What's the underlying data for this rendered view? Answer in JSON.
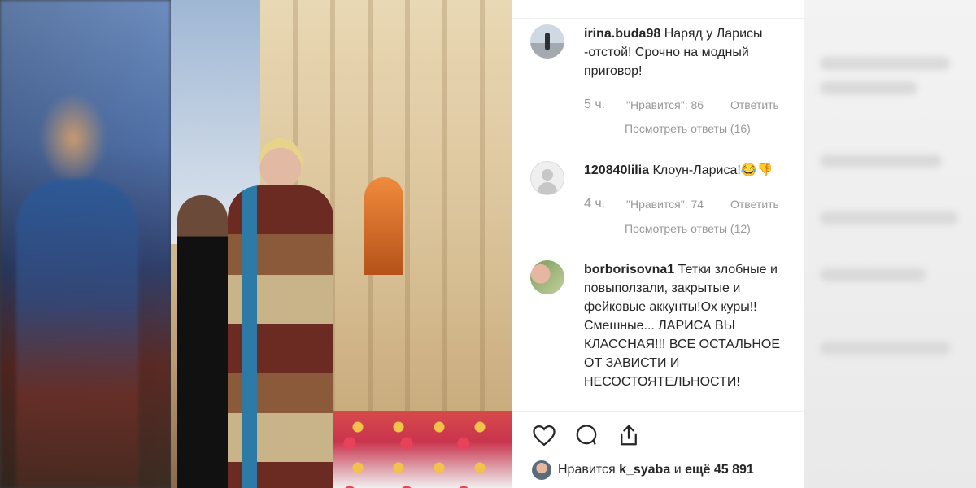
{
  "post": {
    "comments": [
      {
        "username": "irina.buda98",
        "text": "Наряд у Ларисы -отстой! Срочно на модный приговор!",
        "time": "5 ч.",
        "likes": "\"Нравится\": 86",
        "reply": "Ответить",
        "view_replies": "Посмотреть ответы (16)"
      },
      {
        "username": "120840lilia",
        "text": "Клоун-Лариса!😂👎",
        "time": "4 ч.",
        "likes": "\"Нравится\": 74",
        "reply": "Ответить",
        "view_replies": "Посмотреть ответы (12)"
      },
      {
        "username": "borborisovna1",
        "text": "Тетки злобные и повыползали, закрытые и фейковые аккунты!Ох куры!! Смешные... ЛАРИСА ВЫ КЛАССНАЯ!!! ВСЕ ОСТАЛЬНОЕ ОТ ЗАВИСТИ И НЕСОСТОЯТЕЛЬНОСТИ!"
      }
    ],
    "actions": [
      "heart-icon",
      "comment-icon",
      "share-icon"
    ],
    "likes_line": {
      "prefix": "Нравится",
      "user": "k_syaba",
      "middle": "и",
      "rest": "ещё 45 891"
    }
  },
  "colors": {
    "text": "#262626",
    "muted": "#999999",
    "divider": "#efefef"
  }
}
